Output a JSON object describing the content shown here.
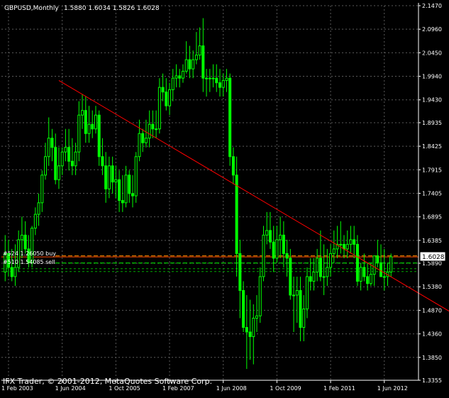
{
  "header": {
    "symbol": "GBPUSD,Monthly",
    "ohlc": "1.5880 1.6034 1.5826 1.6028"
  },
  "price_tag": "1.6028",
  "orders": [
    {
      "label": "#524 1.26050 buy",
      "color": "#ff8c00"
    },
    {
      "label": "#510 1.54085 sell",
      "color": "#00ff00"
    }
  ],
  "watermark": "IFX Trader, © 2001-2012, MetaQuotes Software Corp.",
  "colors": {
    "background": "#000000",
    "grid": "#5a5a5a",
    "candles": "#00ff00",
    "trendline": "#ff0000",
    "price_line": "#ff4d00",
    "text": "#ffffff"
  },
  "chart_data": {
    "type": "candlestick",
    "x_ticks": [
      "1 Feb 2003",
      "1 Jun 2004",
      "1 Oct 2005",
      "1 Feb 2007",
      "1 Jun 2008",
      "1 Oct 2009",
      "1 Feb 2011",
      "1 Jun 2012"
    ],
    "y_ticks": [
      "2.1470",
      "2.0960",
      "2.0450",
      "1.9940",
      "1.9430",
      "1.8935",
      "1.8425",
      "1.7915",
      "1.7405",
      "1.6895",
      "1.6385",
      "1.5890",
      "1.5380",
      "1.4870",
      "1.4360",
      "1.3850",
      "1.3355"
    ],
    "ylim": [
      1.3355,
      2.147
    ],
    "current_price": 1.6028,
    "trendline": {
      "from": [
        "2004-05",
        1.985
      ],
      "to": [
        "2014-03",
        1.478
      ]
    },
    "orders": [
      1.605,
      1.5895
    ],
    "series": {
      "dates": [
        "2003-01",
        "2003-02",
        "2003-03",
        "2003-04",
        "2003-05",
        "2003-06",
        "2003-07",
        "2003-08",
        "2003-09",
        "2003-10",
        "2003-11",
        "2003-12",
        "2004-01",
        "2004-02",
        "2004-03",
        "2004-04",
        "2004-05",
        "2004-06",
        "2004-07",
        "2004-08",
        "2004-09",
        "2004-10",
        "2004-11",
        "2004-12",
        "2005-01",
        "2005-02",
        "2005-03",
        "2005-04",
        "2005-05",
        "2005-06",
        "2005-07",
        "2005-08",
        "2005-09",
        "2005-10",
        "2005-11",
        "2005-12",
        "2006-01",
        "2006-02",
        "2006-03",
        "2006-04",
        "2006-05",
        "2006-06",
        "2006-07",
        "2006-08",
        "2006-09",
        "2006-10",
        "2006-11",
        "2006-12",
        "2007-01",
        "2007-02",
        "2007-03",
        "2007-04",
        "2007-05",
        "2007-06",
        "2007-07",
        "2007-08",
        "2007-09",
        "2007-10",
        "2007-11",
        "2007-12",
        "2008-01",
        "2008-02",
        "2008-03",
        "2008-04",
        "2008-05",
        "2008-06",
        "2008-07",
        "2008-08",
        "2008-09",
        "2008-10",
        "2008-11",
        "2008-12",
        "2009-01",
        "2009-02",
        "2009-03",
        "2009-04",
        "2009-05",
        "2009-06",
        "2009-07",
        "2009-08",
        "2009-09",
        "2009-10",
        "2009-11",
        "2009-12",
        "2010-01",
        "2010-02",
        "2010-03",
        "2010-04",
        "2010-05",
        "2010-06",
        "2010-07",
        "2010-08",
        "2010-09",
        "2010-10",
        "2010-11",
        "2010-12",
        "2011-01",
        "2011-02",
        "2011-03",
        "2011-04",
        "2011-05",
        "2011-06",
        "2011-07",
        "2011-08",
        "2011-09",
        "2011-10",
        "2011-11",
        "2011-12",
        "2012-01",
        "2012-02",
        "2012-03",
        "2012-04",
        "2012-05",
        "2012-06",
        "2012-07",
        "2012-08"
      ],
      "open": [
        1.57,
        1.61,
        1.58,
        1.56,
        1.58,
        1.64,
        1.65,
        1.62,
        1.59,
        1.665,
        1.695,
        1.72,
        1.78,
        1.82,
        1.86,
        1.84,
        1.77,
        1.8,
        1.83,
        1.84,
        1.81,
        1.8,
        1.83,
        1.91,
        1.92,
        1.87,
        1.89,
        1.88,
        1.91,
        1.82,
        1.8,
        1.75,
        1.8,
        1.765,
        1.77,
        1.725,
        1.72,
        1.78,
        1.74,
        1.735,
        1.82,
        1.87,
        1.85,
        1.86,
        1.89,
        1.88,
        1.88,
        1.97,
        1.96,
        1.93,
        1.965,
        1.99,
        1.995,
        1.99,
        2.005,
        2.03,
        2.01,
        2.03,
        2.04,
        2.06,
        1.99,
        1.99,
        1.99,
        1.99,
        1.98,
        1.97,
        1.985,
        1.99,
        1.82,
        1.78,
        1.61,
        1.53,
        1.45,
        1.44,
        1.43,
        1.47,
        1.475,
        1.56,
        1.65,
        1.66,
        1.635,
        1.6,
        1.64,
        1.65,
        1.61,
        1.6,
        1.52,
        1.52,
        1.53,
        1.45,
        1.49,
        1.56,
        1.55,
        1.57,
        1.6,
        1.56,
        1.56,
        1.58,
        1.61,
        1.62,
        1.63,
        1.63,
        1.62,
        1.63,
        1.64,
        1.63,
        1.55,
        1.58,
        1.56,
        1.545,
        1.565,
        1.605,
        1.59,
        1.56,
        1.56,
        1.57
      ],
      "high": [
        1.65,
        1.64,
        1.62,
        1.63,
        1.66,
        1.69,
        1.68,
        1.65,
        1.67,
        1.71,
        1.74,
        1.79,
        1.85,
        1.905,
        1.88,
        1.87,
        1.84,
        1.84,
        1.88,
        1.88,
        1.86,
        1.85,
        1.94,
        1.955,
        1.95,
        1.93,
        1.92,
        1.93,
        1.92,
        1.86,
        1.83,
        1.82,
        1.82,
        1.8,
        1.79,
        1.78,
        1.8,
        1.79,
        1.78,
        1.83,
        1.9,
        1.88,
        1.9,
        1.92,
        1.92,
        1.92,
        1.99,
        2.0,
        1.99,
        1.98,
        2.01,
        2.02,
        2.01,
        2.02,
        2.07,
        2.06,
        2.05,
        2.09,
        2.1,
        2.12,
        2.01,
        2.01,
        2.02,
        2.02,
        2.01,
        2.0,
        2.01,
        2.0,
        1.84,
        1.82,
        1.64,
        1.55,
        1.52,
        1.51,
        1.5,
        1.52,
        1.58,
        1.67,
        1.7,
        1.7,
        1.67,
        1.67,
        1.69,
        1.68,
        1.64,
        1.62,
        1.56,
        1.56,
        1.56,
        1.52,
        1.58,
        1.6,
        1.6,
        1.62,
        1.66,
        1.63,
        1.62,
        1.63,
        1.66,
        1.67,
        1.68,
        1.65,
        1.66,
        1.67,
        1.67,
        1.65,
        1.59,
        1.61,
        1.59,
        1.59,
        1.6,
        1.64,
        1.63,
        1.62,
        1.59,
        1.61
      ],
      "low": [
        1.55,
        1.56,
        1.55,
        1.54,
        1.57,
        1.6,
        1.61,
        1.58,
        1.58,
        1.65,
        1.67,
        1.7,
        1.77,
        1.8,
        1.81,
        1.76,
        1.75,
        1.78,
        1.81,
        1.79,
        1.78,
        1.78,
        1.81,
        1.88,
        1.85,
        1.85,
        1.86,
        1.87,
        1.8,
        1.78,
        1.72,
        1.73,
        1.74,
        1.73,
        1.7,
        1.7,
        1.71,
        1.72,
        1.71,
        1.72,
        1.81,
        1.83,
        1.84,
        1.84,
        1.86,
        1.86,
        1.87,
        1.94,
        1.92,
        1.91,
        1.94,
        1.97,
        1.97,
        1.98,
        2.0,
        1.99,
        1.99,
        2.02,
        2.03,
        1.96,
        1.95,
        1.96,
        1.97,
        1.96,
        1.95,
        1.95,
        1.96,
        1.8,
        1.76,
        1.56,
        1.47,
        1.44,
        1.36,
        1.38,
        1.37,
        1.44,
        1.46,
        1.55,
        1.63,
        1.62,
        1.57,
        1.59,
        1.6,
        1.58,
        1.56,
        1.51,
        1.44,
        1.46,
        1.42,
        1.42,
        1.47,
        1.53,
        1.53,
        1.55,
        1.55,
        1.52,
        1.54,
        1.56,
        1.59,
        1.6,
        1.61,
        1.6,
        1.6,
        1.61,
        1.6,
        1.54,
        1.53,
        1.55,
        1.53,
        1.54,
        1.54,
        1.58,
        1.57,
        1.53,
        1.54,
        1.56
      ],
      "close": [
        1.61,
        1.58,
        1.56,
        1.58,
        1.64,
        1.65,
        1.62,
        1.59,
        1.665,
        1.695,
        1.72,
        1.78,
        1.82,
        1.86,
        1.84,
        1.77,
        1.8,
        1.83,
        1.84,
        1.81,
        1.8,
        1.83,
        1.91,
        1.92,
        1.87,
        1.89,
        1.88,
        1.91,
        1.82,
        1.8,
        1.75,
        1.8,
        1.765,
        1.77,
        1.725,
        1.72,
        1.78,
        1.74,
        1.735,
        1.82,
        1.87,
        1.85,
        1.86,
        1.89,
        1.88,
        1.88,
        1.97,
        1.96,
        1.93,
        1.965,
        1.99,
        1.995,
        1.99,
        2.005,
        2.03,
        2.01,
        2.03,
        2.04,
        2.06,
        1.99,
        1.99,
        1.99,
        1.99,
        1.98,
        1.97,
        1.985,
        1.99,
        1.82,
        1.78,
        1.61,
        1.53,
        1.45,
        1.44,
        1.43,
        1.47,
        1.475,
        1.56,
        1.65,
        1.66,
        1.635,
        1.6,
        1.64,
        1.65,
        1.61,
        1.6,
        1.52,
        1.52,
        1.53,
        1.45,
        1.49,
        1.56,
        1.55,
        1.57,
        1.6,
        1.56,
        1.56,
        1.58,
        1.61,
        1.62,
        1.63,
        1.63,
        1.62,
        1.63,
        1.64,
        1.63,
        1.55,
        1.58,
        1.56,
        1.545,
        1.565,
        1.605,
        1.59,
        1.56,
        1.56,
        1.57,
        1.603
      ]
    }
  }
}
